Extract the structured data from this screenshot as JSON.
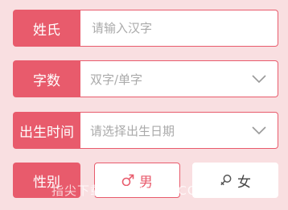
{
  "form": {
    "name": {
      "label": "姓氏",
      "placeholder": "请输入汉字",
      "value": ""
    },
    "chars": {
      "label": "字数",
      "selected": "双字/单字",
      "icon": "chevron-down-icon"
    },
    "birth": {
      "label": "出生时间",
      "selected": "请选择出生日期",
      "icon": "chevron-down-icon"
    },
    "gender": {
      "label": "性别",
      "male": {
        "symbol": "♂",
        "text": "男",
        "icon": "male-icon"
      },
      "female": {
        "symbol": "♀",
        "text": "女",
        "icon": "female-icon"
      },
      "selected": "male"
    }
  },
  "watermark": "指尖下载站 ZJHHGH.COM",
  "colors": {
    "background": "#f9dfe1",
    "accent": "#e85b6c",
    "field_bg": "#ffffff",
    "placeholder": "#aaaaaa"
  }
}
